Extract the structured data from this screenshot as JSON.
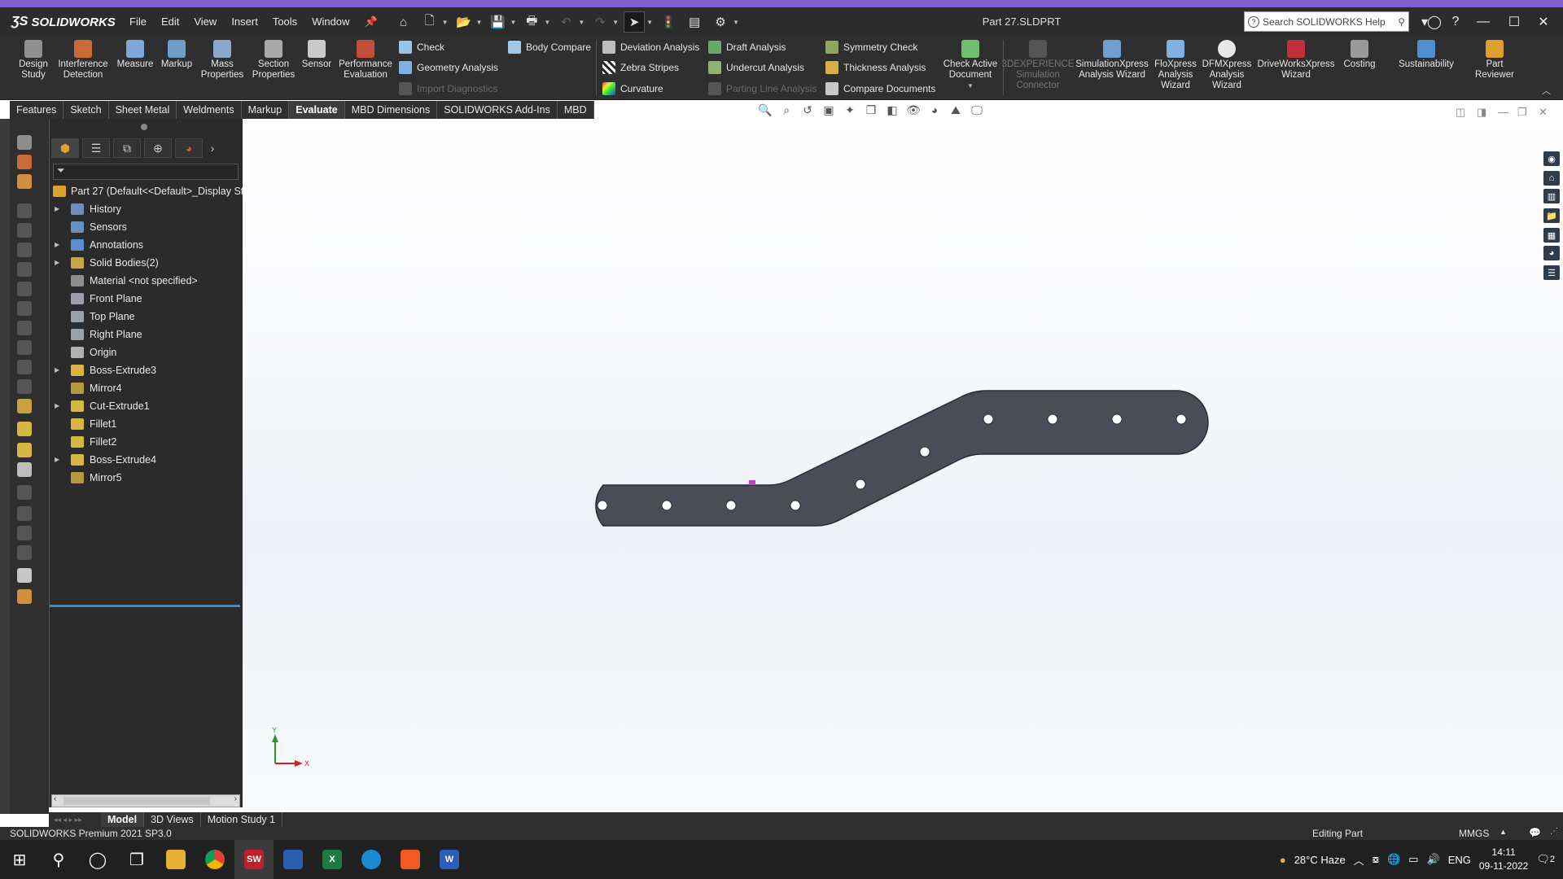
{
  "app": {
    "brand": "SOLIDWORKS",
    "doc_title": "Part 27.SLDPRT"
  },
  "menu": [
    "File",
    "Edit",
    "View",
    "Insert",
    "Tools",
    "Window"
  ],
  "search": {
    "placeholder": "Search SOLIDWORKS Help"
  },
  "ribbon": {
    "design_study": "Design Study",
    "interference": "Interference Detection",
    "measure": "Measure",
    "markup": "Markup",
    "mass_properties": "Mass Properties",
    "section_properties": "Section Properties",
    "sensor": "Sensor",
    "performance": "Performance Evaluation",
    "check": "Check",
    "geometry_analysis": "Geometry Analysis",
    "import_diagnostics": "Import Diagnostics",
    "body_compare": "Body Compare",
    "deviation_analysis": "Deviation Analysis",
    "zebra_stripes": "Zebra Stripes",
    "curvature": "Curvature",
    "draft_analysis": "Draft Analysis",
    "undercut_analysis": "Undercut Analysis",
    "parting_line": "Parting Line Analysis",
    "symmetry_check": "Symmetry Check",
    "thickness_analysis": "Thickness Analysis",
    "compare_documents": "Compare Documents",
    "check_active": "Check Active Document",
    "experience": "3DEXPERIENCE Simulation Connector",
    "simxpress": "SimulationXpress Analysis Wizard",
    "floxpress": "FloXpress Analysis Wizard",
    "dfmxpress": "DFMXpress Analysis Wizard",
    "driveworks": "DriveWorksXpress Wizard",
    "costing": "Costing",
    "sustainability": "Sustainability",
    "part_reviewer": "Part Reviewer"
  },
  "tabs": [
    "Features",
    "Sketch",
    "Sheet Metal",
    "Weldments",
    "Markup",
    "Evaluate",
    "MBD Dimensions",
    "SOLIDWORKS Add-Ins",
    "MBD"
  ],
  "active_tab": "Evaluate",
  "tree": {
    "root": "Part 27  (Default<<Default>_Display Sta",
    "items": [
      {
        "label": "History",
        "expand": true,
        "icon": "history-icon",
        "color": "#6a8fc0"
      },
      {
        "label": "Sensors",
        "expand": false,
        "icon": "sensors-icon",
        "color": "#6a8fc0"
      },
      {
        "label": "Annotations",
        "expand": true,
        "icon": "annotations-icon",
        "color": "#5a8fd0"
      },
      {
        "label": "Solid Bodies(2)",
        "expand": true,
        "icon": "solid-bodies-icon",
        "color": "#c8a44a"
      },
      {
        "label": "Material <not specified>",
        "expand": false,
        "icon": "material-icon",
        "color": "#8e8e8e"
      },
      {
        "label": "Front Plane",
        "expand": false,
        "icon": "plane-icon",
        "color": "#9aa0a8"
      },
      {
        "label": "Top Plane",
        "expand": false,
        "icon": "plane-icon",
        "color": "#9aa0a8"
      },
      {
        "label": "Right Plane",
        "expand": false,
        "icon": "plane-icon",
        "color": "#9aa0a8"
      },
      {
        "label": "Origin",
        "expand": false,
        "icon": "origin-icon",
        "color": "#b0b0b0"
      },
      {
        "label": "Boss-Extrude3",
        "expand": true,
        "icon": "boss-extrude-icon",
        "color": "#d6b640"
      },
      {
        "label": "Mirror4",
        "expand": false,
        "icon": "mirror-icon",
        "color": "#b59a3a"
      },
      {
        "label": "Cut-Extrude1",
        "expand": true,
        "icon": "cut-extrude-icon",
        "color": "#d6b640"
      },
      {
        "label": "Fillet1",
        "expand": false,
        "icon": "fillet-icon",
        "color": "#d6b640"
      },
      {
        "label": "Fillet2",
        "expand": false,
        "icon": "fillet-icon",
        "color": "#d6b640"
      },
      {
        "label": "Boss-Extrude4",
        "expand": true,
        "icon": "boss-extrude-icon",
        "color": "#d6b640"
      },
      {
        "label": "Mirror5",
        "expand": false,
        "icon": "mirror-icon",
        "color": "#b59a3a"
      }
    ]
  },
  "bottom_tabs": [
    "Model",
    "3D Views",
    "Motion Study 1"
  ],
  "status": {
    "left": "SOLIDWORKS Premium 2021 SP3.0",
    "mode": "Editing Part",
    "units": "MMGS"
  },
  "triad": {
    "y": "Y",
    "x": "X"
  },
  "tray": {
    "weather": "28°C  Haze",
    "lang": "ENG",
    "time": "14:11",
    "date": "09-11-2022",
    "notif": "2"
  },
  "colors": {
    "part": "#4a4c56",
    "accent": "#2e8fd6",
    "titlebar": "#2c2c2c"
  }
}
